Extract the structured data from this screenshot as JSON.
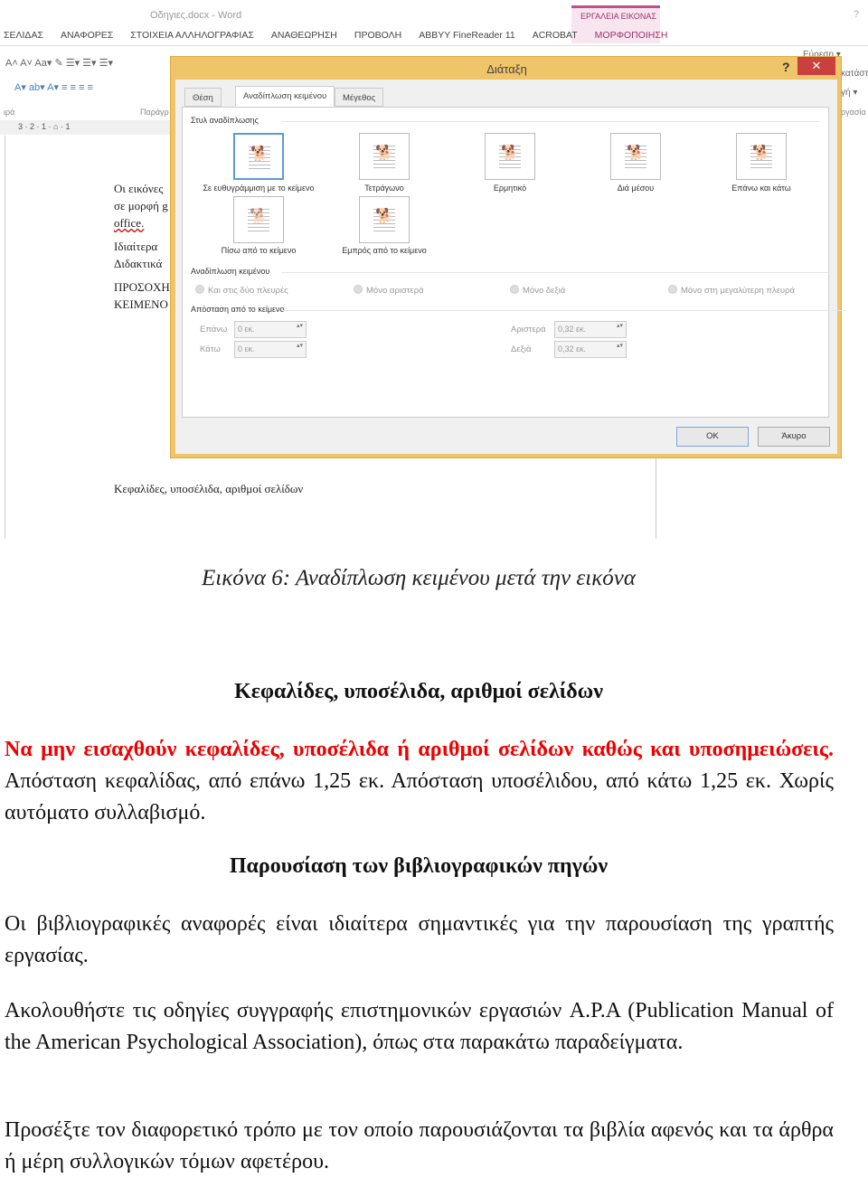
{
  "screenshot": {
    "window_title": "Οδηγιες.docx - Word",
    "help": "?",
    "context_group": "ΕΡΓΑΛΕΙΑ ΕΙΚΟΝΑΣ",
    "ribbon_tabs": [
      "ΣΕΛΙΔΑΣ",
      "ΑΝΑΦΟΡΕΣ",
      "ΣΤΟΙΧΕΙΑ ΑΛΛΗΛΟΓΡΑΦΙΑΣ",
      "ΑΝΑΘΕΩΡΗΣΗ",
      "ΠΡΟΒΟΛΗ",
      "ABBYY FineReader 11",
      "ACROBAT",
      "ΜΟΡΦΟΠΟΙΗΣΗ"
    ],
    "ribbon": {
      "font_row1": "A˄ A˅  Aa▾  ✎  ☰▾ ☰▾ ☰▾",
      "font_row2": "A▾  ab▾  A▾   ≡ ≡ ≡ ≡",
      "group_font": "ιρά",
      "group_paragraph": "Παράγρ",
      "find": "Εύρεση ▾",
      "replace": "κατάστ",
      "select": "γή ▾",
      "group_editing": "ργασία"
    },
    "ruler": "3 · 2 · 1 · ⌂ · 1",
    "doc_lines": [
      "Οι εικόνες",
      "σε μορφή g",
      "office.",
      "Ιδιαίτερα",
      "Διδακτικά",
      "ΠΡΟΣΟΧΗ",
      "ΚΕΙΜΕΝΟ"
    ],
    "doc_heading": "Κεφαλίδες, υποσέλιδα, αριθμοί σελίδων",
    "dialog": {
      "title": "Διάταξη",
      "help": "?",
      "close": "✕",
      "tabs": [
        "Θέση",
        "Αναδίπλωση κειμένου",
        "Μέγεθος"
      ],
      "active_tab": "Αναδίπλωση κειμένου",
      "wrap_style_label": "Στυλ αναδίπλωσης",
      "wrap_styles": [
        "Σε ευθυγράμμιση με το κείμενο",
        "Τετράγωνο",
        "Ερμητικό",
        "Διά μέσου",
        "Επάνω και κάτω",
        "Πίσω από το κείμενο",
        "Εμπρός από το κείμενο"
      ],
      "selected_wrap_style": "Σε ευθυγράμμιση με το κείμενο",
      "wrap_text_label": "Αναδίπλωση κειμένου",
      "wrap_text_options": [
        "Και στις δύο πλευρές",
        "Μόνο αριστερά",
        "Μόνο δεξιά",
        "Μόνο στη μεγαλύτερη πλευρά"
      ],
      "distance_label": "Απόσταση από το κείμενο",
      "distance": {
        "top_label": "Επάνω",
        "top": "0 εκ.",
        "bottom_label": "Κάτω",
        "bottom": "0 εκ.",
        "left_label": "Αριστερά",
        "left": "0,32 εκ.",
        "right_label": "Δεξιά",
        "right": "0,32 εκ."
      },
      "ok": "OK",
      "cancel": "Άκυρο"
    }
  },
  "caption": "Εικόνα 6: Αναδίπλωση κειμένου μετά την εικόνα",
  "heading1": "Κεφαλίδες, υποσέλιδα, αριθμοί σελίδων",
  "para1_red": "Να μην εισαχθούν κεφαλίδες, υποσέλιδα ή αριθμοί σελίδων καθώς και υποσημειώσεις.",
  "para1_rest": " Απόσταση κεφαλίδας, από επάνω 1,25 εκ. Απόσταση υποσέλιδου, από κάτω 1,25 εκ. Χωρίς αυτόματο συλλαβισμό.",
  "heading2": "Παρουσίαση των βιβλιογραφικών πηγών",
  "para2": "Οι βιβλιογραφικές αναφορές είναι ιδιαίτερα σημαντικές για την παρουσίαση της γραπτής εργασίας.",
  "para3": "Ακολουθήστε τις οδηγίες συγγραφής επιστημονικών εργασιών  A.P.A (Publication Manual of the American Psychological Association), όπως στα παρακάτω παραδείγματα.",
  "para4": "Προσέξτε τον διαφορετικό τρόπο με τον οποίο παρουσιάζονται τα βιβλία αφενός και τα άρθρα ή μέρη συλλογικών τόμων αφετέρου.",
  "colors": {
    "dialog_border": "#f0c468",
    "close_button": "#c9413e",
    "context_tab": "#c0508a",
    "red_text": "#e00000"
  }
}
